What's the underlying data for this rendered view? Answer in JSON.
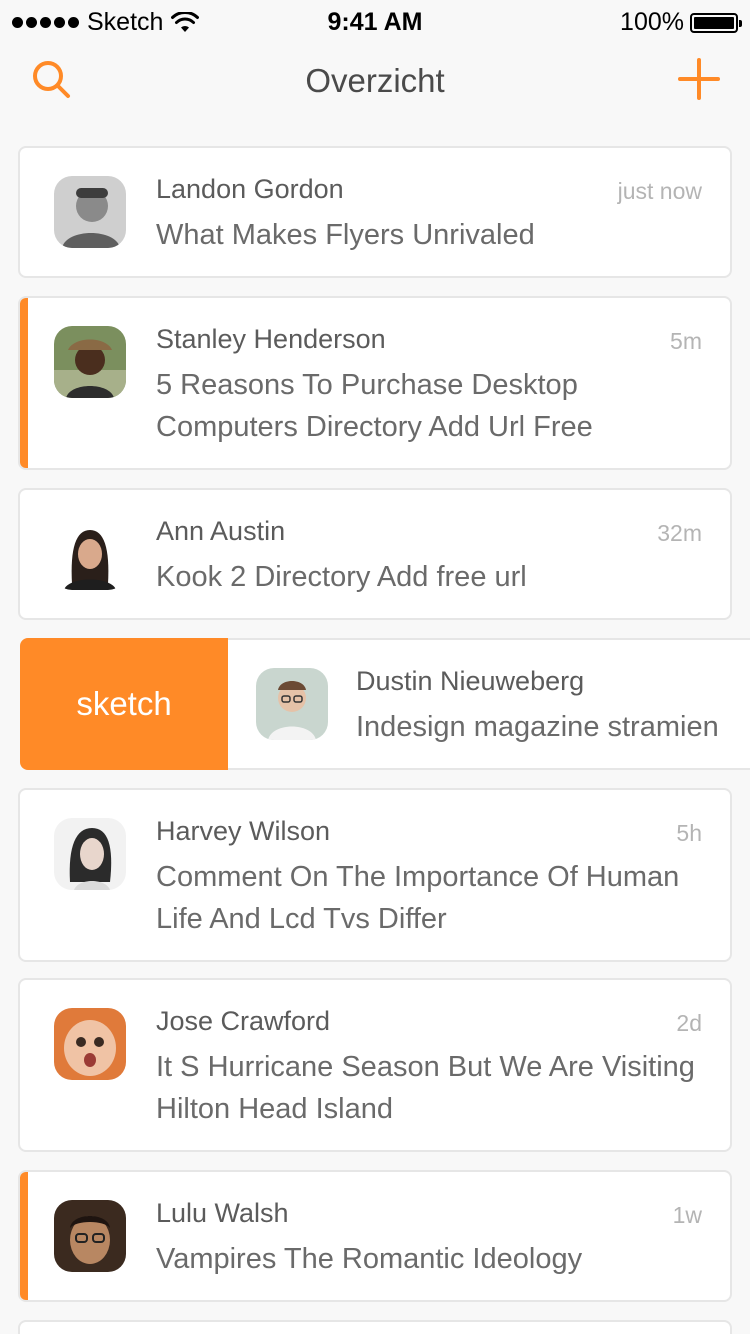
{
  "status_bar": {
    "carrier": "Sketch",
    "time": "9:41 AM",
    "battery": "100%"
  },
  "nav": {
    "title": "Overzicht",
    "search_icon": "search-icon",
    "add_icon": "plus-icon",
    "accent_color": "#ff8a27"
  },
  "messages": [
    {
      "name": "Landon Gordon",
      "time": "just now",
      "subject": "What Makes Flyers Unrivaled",
      "flagged": false
    },
    {
      "name": "Stanley Henderson",
      "time": "5m",
      "subject": "5 Reasons To Purchase Desktop Computers Directory Add Url Free",
      "flagged": true
    },
    {
      "name": "Ann Austin",
      "time": "32m",
      "subject": "Kook 2 Directory Add free url",
      "flagged": false
    },
    {
      "name": "Harvey Wilson",
      "time": "5h",
      "subject": "Comment On The Importance Of Human Life And Lcd Tvs Differ",
      "flagged": false
    },
    {
      "name": "Jose Crawford",
      "time": "2d",
      "subject": "It S Hurricane Season But We Are Visiting Hilton Head Island",
      "flagged": false
    },
    {
      "name": "Lulu Walsh",
      "time": "1w",
      "subject": "Vampires The Romantic Ideology",
      "flagged": true
    }
  ],
  "swiped": {
    "action_label": "sketch",
    "name": "Dustin Nieuweberg",
    "subject": "Indesign magazine stramien"
  }
}
